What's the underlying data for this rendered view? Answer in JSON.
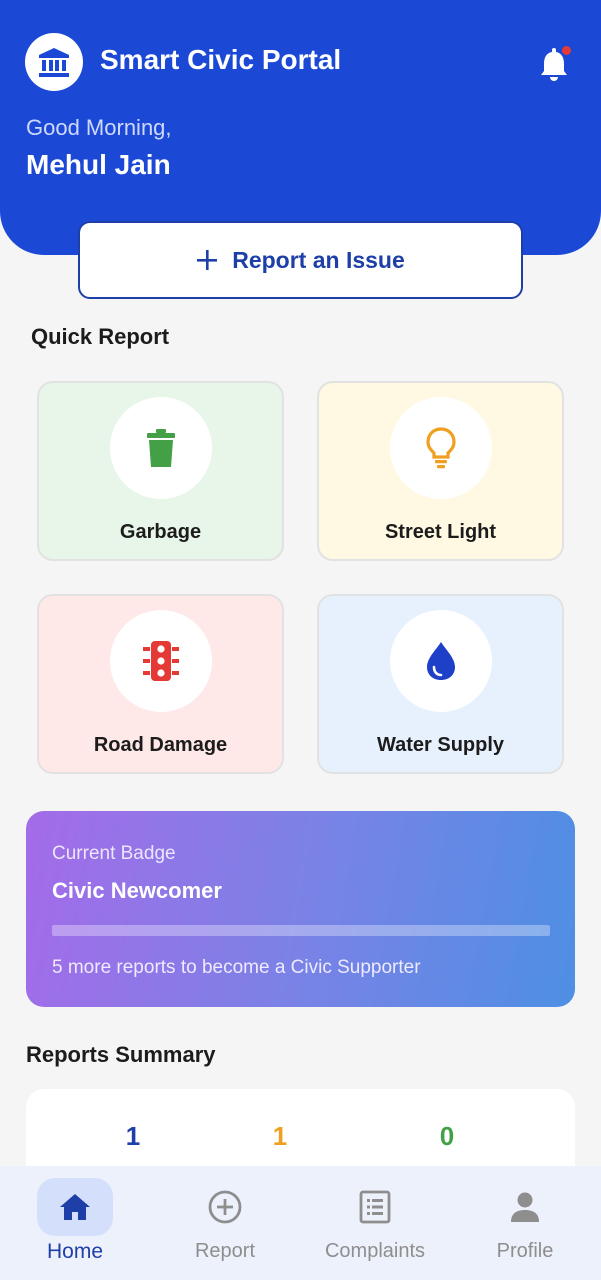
{
  "header": {
    "app_title": "Smart Civic Portal",
    "greeting": "Good Morning,",
    "user_name": "Mehul Jain",
    "logo_icon": "bank-building-icon",
    "notification_icon": "bell-icon",
    "has_unread_notification": true,
    "colors": {
      "background": "#1b49d6",
      "notification_dot": "#e53935"
    }
  },
  "report_button": {
    "label": "Report an Issue",
    "icon": "plus-icon"
  },
  "quick_report": {
    "title": "Quick Report",
    "items": [
      {
        "label": "Garbage",
        "icon": "trash-can-icon",
        "tile_color": "#e8f5e9",
        "icon_color": "#43a047"
      },
      {
        "label": "Street Light",
        "icon": "light-bulb-icon",
        "tile_color": "#fff8e3",
        "icon_color": "#f0a020"
      },
      {
        "label": "Road Damage",
        "icon": "traffic-light-icon",
        "tile_color": "#ffe8e8",
        "icon_color": "#e53935"
      },
      {
        "label": "Water Supply",
        "icon": "water-drop-icon",
        "tile_color": "#e6f1fd",
        "icon_color": "#1e40c8"
      }
    ]
  },
  "badge": {
    "caption": "Current Badge",
    "title": "Civic Newcomer",
    "progress": 0,
    "note": "5 more reports to become a Civic Supporter"
  },
  "reports_summary": {
    "title": "Reports Summary",
    "values": [
      {
        "value": "1",
        "color": "#1e3fa8"
      },
      {
        "value": "1",
        "color": "#f0a020"
      },
      {
        "value": "0",
        "color": "#43a047"
      }
    ]
  },
  "bottom_nav": {
    "items": [
      {
        "label": "Home",
        "icon": "home-icon",
        "active": true
      },
      {
        "label": "Report",
        "icon": "plus-circle-icon",
        "active": false
      },
      {
        "label": "Complaints",
        "icon": "list-document-icon",
        "active": false
      },
      {
        "label": "Profile",
        "icon": "person-icon",
        "active": false
      }
    ]
  }
}
